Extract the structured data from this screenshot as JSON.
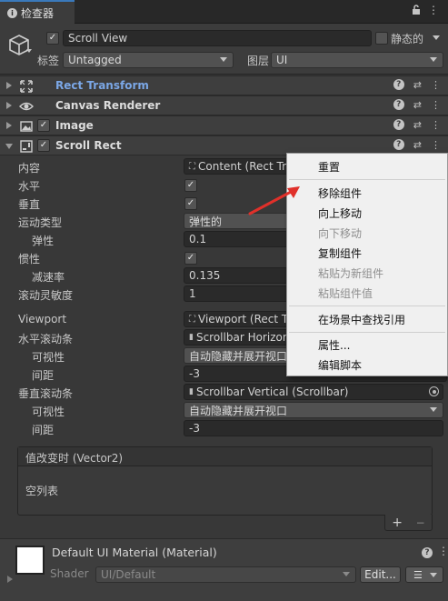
{
  "window": {
    "tab_title": "检查器"
  },
  "object": {
    "name": "Scroll View",
    "static_label": "静态的",
    "tag_label": "标签",
    "tag_value": "Untagged",
    "layer_label": "图层",
    "layer_value": "UI"
  },
  "components": [
    {
      "name": "Rect Transform"
    },
    {
      "name": "Canvas Renderer"
    },
    {
      "name": "Image"
    },
    {
      "name": "Scroll Rect"
    }
  ],
  "scroll_rect": {
    "content_label": "内容",
    "content_value": "Content (Rect Tra",
    "horizontal_label": "水平",
    "vertical_label": "垂直",
    "movement_label": "运动类型",
    "movement_value": "弹性的",
    "elasticity_label": "弹性",
    "elasticity_value": "0.1",
    "inertia_label": "惯性",
    "deceleration_label": "减速率",
    "deceleration_value": "0.135",
    "sensitivity_label": "滚动灵敏度",
    "sensitivity_value": "1",
    "viewport_label": "Viewport",
    "viewport_value": "Viewport (Rect T",
    "hscroll_label": "水平滚动条",
    "hscroll_value": "Scrollbar Horizon",
    "hvis_label": "可视性",
    "hvis_value": "自动隐藏并展开视口",
    "hspacing_label": "间距",
    "hspacing_value": "-3",
    "vscroll_label": "垂直滚动条",
    "vscroll_value": "Scrollbar Vertical (Scrollbar)",
    "vvis_label": "可视性",
    "vvis_value": "自动隐藏并展开视口",
    "vspacing_label": "间距",
    "vspacing_value": "-3"
  },
  "event": {
    "header": "值改变时 (Vector2)",
    "empty_text": "空列表",
    "add": "+",
    "remove": "−"
  },
  "material": {
    "name": "Default UI Material (Material)",
    "shader_label": "Shader",
    "shader_value": "UI/Default",
    "edit_label": "Edit..."
  },
  "context_menu": {
    "items": [
      "重置",
      "移除组件",
      "向上移动",
      "向下移动",
      "复制组件",
      "粘贴为新组件",
      "粘贴组件值",
      "在场景中查找引用",
      "属性...",
      "编辑脚本"
    ]
  },
  "colors": {
    "panel": "#383838",
    "accent": "#3a79bb",
    "link_blue": "#7ba7e6",
    "arrow_red": "#e0302a"
  }
}
